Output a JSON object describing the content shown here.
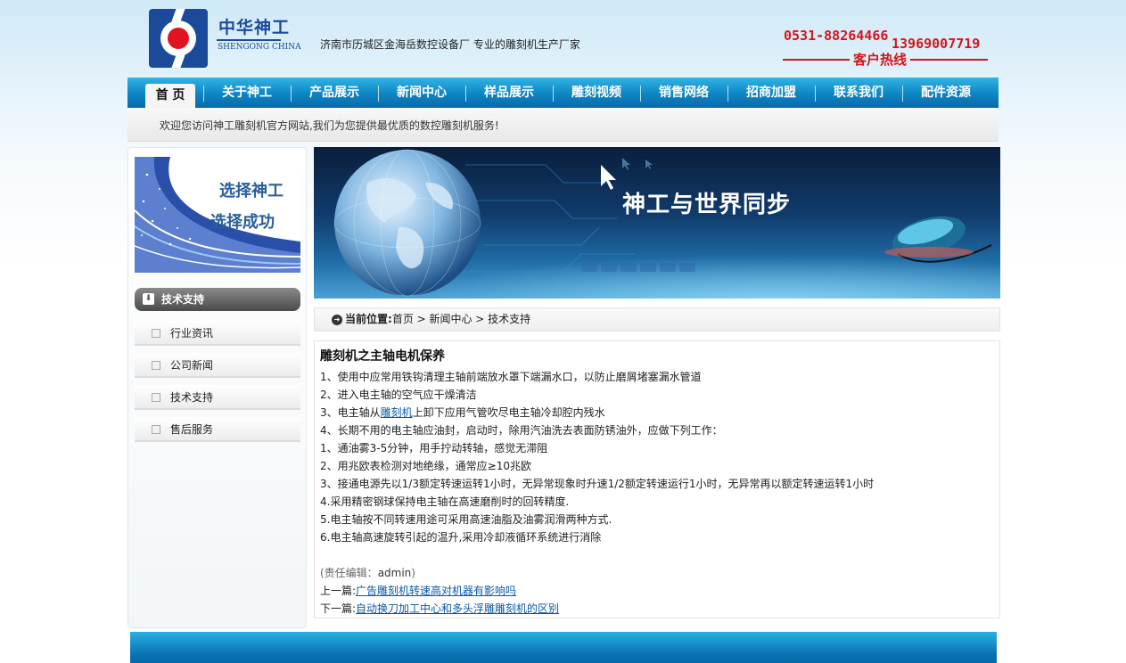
{
  "header": {
    "logo_cn": "中华神工",
    "logo_en": "SHENGONG CHINA",
    "slogan": "济南市历城区金海岳数控设备厂 专业的雕刻机生产厂家",
    "phone_1": "0531-88264466",
    "phone_2": "13969007719",
    "hotline_label": "客户热线"
  },
  "nav": {
    "items": [
      {
        "label": "首 页"
      },
      {
        "label": "关于神工"
      },
      {
        "label": "产品展示"
      },
      {
        "label": "新闻中心"
      },
      {
        "label": "样品展示"
      },
      {
        "label": "雕刻视频"
      },
      {
        "label": "销售网络"
      },
      {
        "label": "招商加盟"
      },
      {
        "label": "联系我们"
      },
      {
        "label": "配件资源"
      }
    ],
    "active_index": 0
  },
  "welcome": "欢迎您访问神工雕刻机官方网站,我们为您提供最优质的数控雕刻机服务!",
  "sidebar": {
    "promo_line_1": "选择神工",
    "promo_line_2": "选择成功",
    "heading": "技术支持",
    "items": [
      {
        "label": "行业资讯"
      },
      {
        "label": "公司新闻"
      },
      {
        "label": "技术支持"
      },
      {
        "label": "售后服务"
      }
    ]
  },
  "banner": {
    "text": "神工与世界同步"
  },
  "breadcrumb": {
    "label": "当前位置:",
    "trail": "首页 > 新闻中心 > 技术支持"
  },
  "article": {
    "title": "雕刻机之主轴电机保养",
    "line_1": "1、使用中应常用铁钩清理主轴前端放水罩下端漏水口，以防止磨屑堵塞漏水管道",
    "line_2": "2、进入电主轴的空气应干燥清洁",
    "line_3_pre": "3、电主轴从",
    "line_3_link": "雕刻机",
    "line_3_post": "上卸下应用气管吹尽电主轴冷却腔内残水",
    "line_4": "4、长期不用的电主轴应油封，启动时，除用汽油洗去表面防锈油外，应做下列工作：",
    "line_5": "1、通油雾3-5分钟，用手拧动转轴，感觉无滞阻",
    "line_6": "2、用兆欧表检测对地绝缘，通常应≥10兆欧",
    "line_7": "3、接通电源先以1/3额定转速运转1小时，无异常现象时升速1/2额定转速运行1小时，无异常再以额定转速运转1小时",
    "line_8": "4.采用精密钢球保持电主轴在高速磨削时的回转精度.",
    "line_9": "5.电主轴按不同转速用途可采用高速油脂及油雾润滑两种方式.",
    "line_10": "6.电主轴高速旋转引起的温升,采用冷却液循环系统进行消除",
    "author_pre": "(责任编辑：",
    "author_name": "admin",
    "author_post": ")",
    "prev_label": "上一篇:",
    "prev_link": "广告雕刻机转速高对机器有影响吗",
    "next_label": "下一篇:",
    "next_link": "自动换刀加工中心和多头浮雕雕刻机的区别"
  },
  "colors": {
    "nav_blue": "#0d84c4",
    "brand_blue": "#1b4a9a",
    "hotline_red": "#d4151d",
    "link_blue": "#0a5aa8"
  }
}
